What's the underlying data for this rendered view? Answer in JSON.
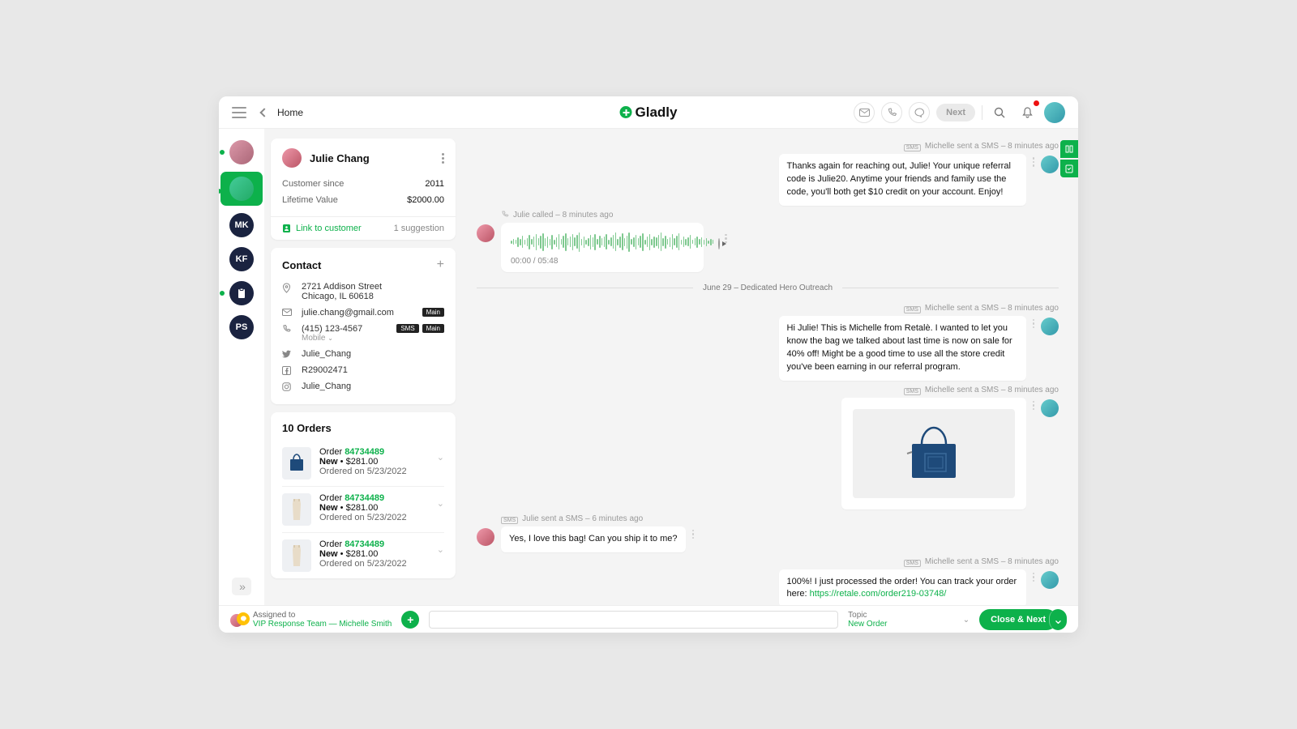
{
  "header": {
    "home": "Home",
    "brand": "Gladly",
    "next": "Next"
  },
  "rail": {
    "items": [
      {
        "initials": "",
        "img": true,
        "selected": false,
        "online": true
      },
      {
        "initials": "",
        "img": true,
        "selected": true,
        "online": true,
        "green": true
      },
      {
        "initials": "MK",
        "img": false,
        "selected": false,
        "online": false
      },
      {
        "initials": "KF",
        "img": false,
        "selected": false,
        "online": false
      },
      {
        "initials": "",
        "img": false,
        "selected": false,
        "online": true,
        "clip": true
      },
      {
        "initials": "PS",
        "img": false,
        "selected": false,
        "online": false
      }
    ],
    "expand": "»"
  },
  "customer": {
    "name": "Julie Chang",
    "since_label": "Customer since",
    "since_value": "2011",
    "ltv_label": "Lifetime Value",
    "ltv_value": "$2000.00",
    "link_label": "Link to customer",
    "suggestion": "1 suggestion"
  },
  "contact": {
    "title": "Contact",
    "address1": "2721 Addison Street",
    "address2": "Chicago, IL 60618",
    "email": "julie.chang@gmail.com",
    "email_badge": "Main",
    "phone": "(415) 123-4567",
    "phone_sub": "Mobile",
    "phone_badges": [
      "SMS",
      "Main"
    ],
    "twitter": "Julie_Chang",
    "facebook": "R29002471",
    "instagram": "Julie_Chang"
  },
  "orders": {
    "title": "10 Orders",
    "items": [
      {
        "label": "Order ",
        "id": "84734489",
        "status": "New",
        "price": "$281.00",
        "date": "Ordered on 5/23/2022",
        "thumb": "bag"
      },
      {
        "label": "Order ",
        "id": "84734489",
        "status": "New",
        "price": "$281.00",
        "date": "Ordered on 5/23/2022",
        "thumb": "dress"
      },
      {
        "label": "Order ",
        "id": "84734489",
        "status": "New",
        "price": "$281.00",
        "date": "Ordered on 5/23/2022",
        "thumb": "dress"
      }
    ]
  },
  "conversation": {
    "m1_meta": "Michelle sent a SMS – 8 minutes ago",
    "m1_text": "Thanks again for reaching out, Julie! Your unique referral code is Julie20. Anytime your friends and family use the code, you'll both get $10 credit on your account. Enjoy!",
    "call_meta": "Julie called – 8 minutes ago",
    "call_time": "00:00 / 05:48",
    "divider": "June 29 – Dedicated Hero Outreach",
    "m2_meta": "Michelle sent a SMS – 8 minutes ago",
    "m2_text": "Hi Julie! This is Michelle from Retalè. I wanted to let you know the bag we talked about last time is now on sale for 40% off! Might be a good time to use all the store credit you've been earning in our referral program.",
    "m3_meta": "Michelle sent a SMS – 8 minutes ago",
    "m4_meta": "Julie sent a SMS – 6 minutes ago",
    "m4_text": "Yes, I love this bag! Can you ship it to me?",
    "m5_meta": "Michelle sent a SMS – 8 minutes ago",
    "m5_text": "100%! I just processed the order! You can track your order here: ",
    "m5_link": "https://retale.com/order219-03748/"
  },
  "footer": {
    "assigned_label": "Assigned to",
    "assigned_value": "VIP Response Team  —  Michelle Smith",
    "topic_label": "Topic",
    "topic_value": "New Order",
    "close": "Close & Next"
  }
}
